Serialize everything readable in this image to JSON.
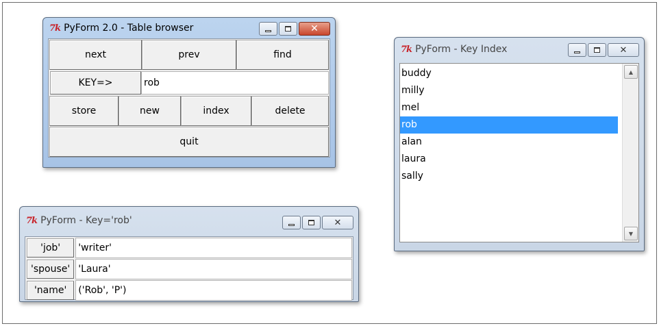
{
  "table_browser": {
    "title": "PyForm 2.0 - Table browser",
    "buttons_row1": [
      "next",
      "prev",
      "find"
    ],
    "key_label": "KEY=>",
    "key_value": "rob",
    "buttons_row2": [
      "store",
      "new",
      "index",
      "delete"
    ],
    "quit_label": "quit"
  },
  "key_index": {
    "title": "PyForm - Key Index",
    "items": [
      "buddy",
      "milly",
      "mel",
      "rob",
      "alan",
      "laura",
      "sally"
    ],
    "selected": "rob"
  },
  "record": {
    "title": "PyForm - Key='rob'",
    "fields": [
      {
        "key": "'job'",
        "value": "'writer'"
      },
      {
        "key": "'spouse'",
        "value": "'Laura'"
      },
      {
        "key": "'name'",
        "value": "('Rob', 'P')"
      }
    ]
  },
  "icons": {
    "app_icon": "tk-feather-icon",
    "minimize": "minimize-icon",
    "maximize": "maximize-icon",
    "close": "close-icon"
  },
  "colors": {
    "selection": "#3399ff",
    "close_active": "#c9472d",
    "tk_icon": "#c8232a"
  }
}
